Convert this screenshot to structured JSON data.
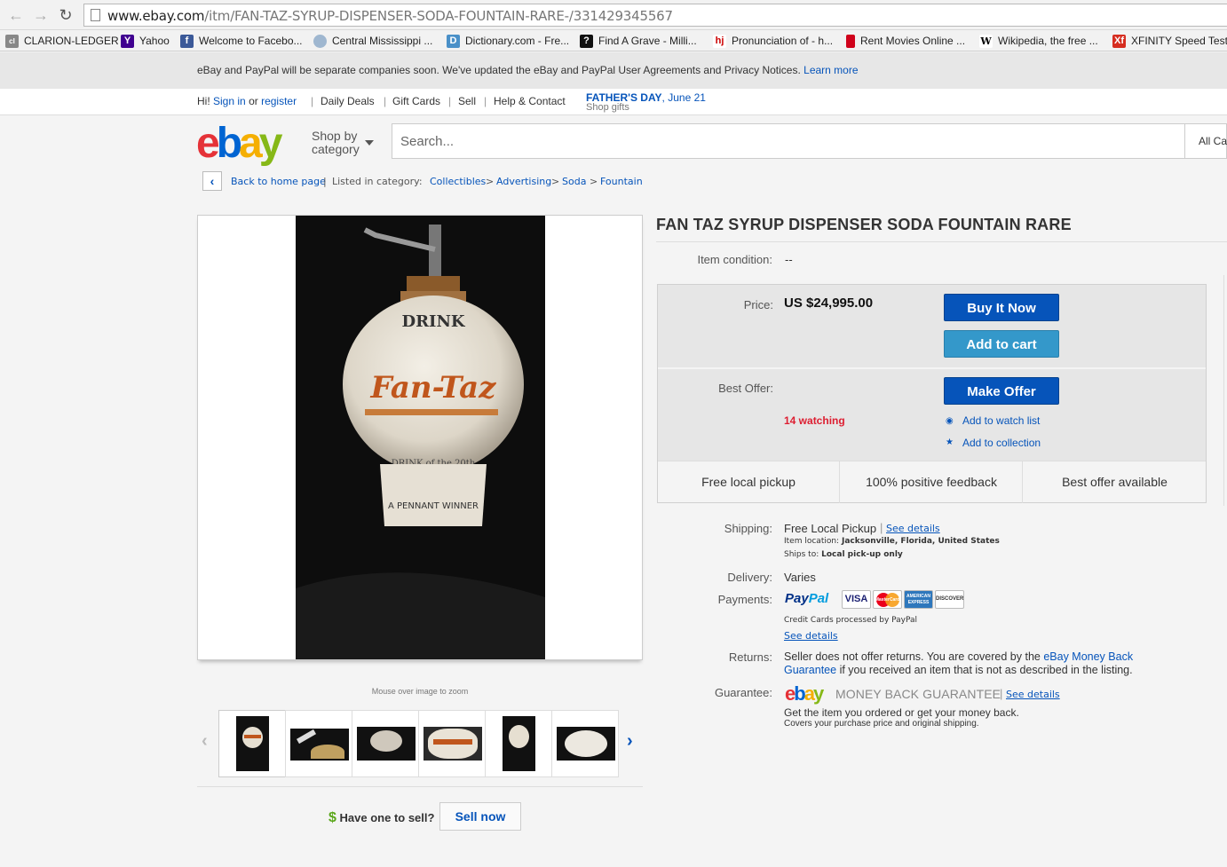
{
  "browser": {
    "url_domain": "www.ebay.com",
    "url_path": "/itm/FAN-TAZ-SYRUP-DISPENSER-SODA-FOUNTAIN-RARE-/331429345567",
    "bookmarks": [
      {
        "label": "CLARION-LEDGER",
        "icon": "cl-icon",
        "color": "#777777"
      },
      {
        "label": "Yahoo",
        "icon": "yahoo-icon",
        "color": "#400090"
      },
      {
        "label": "Welcome to Facebo...",
        "icon": "facebook-icon",
        "color": "#3b5998"
      },
      {
        "label": "Central Mississippi ...",
        "icon": "globe-icon",
        "color": "#6a8fb8"
      },
      {
        "label": "Dictionary.com - Fre...",
        "icon": "dictionary-icon",
        "color": "#4a90c8"
      },
      {
        "label": "Find A Grave - Milli...",
        "icon": "findagrave-icon",
        "color": "#111111"
      },
      {
        "label": "Pronunciation of - h...",
        "icon": "hj-icon",
        "color": "#cc0000"
      },
      {
        "label": "Rent Movies Online ...",
        "icon": "redbox-icon",
        "color": "#d0021b"
      },
      {
        "label": "Wikipedia, the free ...",
        "icon": "wikipedia-icon",
        "color": "#ffffff"
      },
      {
        "label": "XFINITY Speed Test",
        "icon": "xfinity-icon",
        "color": "#d62d20"
      }
    ]
  },
  "notice": {
    "text": "eBay and PayPal will be separate companies soon. We've updated the eBay and PayPal User Agreements and Privacy Notices.",
    "link": "Learn more"
  },
  "toplinks": {
    "hi": "Hi!",
    "sign_in": "Sign in",
    "or": "or",
    "register": "register",
    "daily_deals": "Daily Deals",
    "gift_cards": "Gift Cards",
    "sell": "Sell",
    "help": "Help & Contact",
    "promo_title": "FATHER'S DAY",
    "promo_date": ", June 21",
    "promo_sub": "Shop gifts"
  },
  "header": {
    "logo": [
      "e",
      "b",
      "a",
      "y"
    ],
    "shop_by_1": "Shop by",
    "shop_by_2": "category",
    "search_placeholder": "Search...",
    "search_category": "All Ca"
  },
  "breadcrumb": {
    "back": "Back to home page",
    "listed": "Listed in category:",
    "items": [
      "Collectibles",
      "Advertising",
      "Soda",
      "Fountain"
    ]
  },
  "gallery": {
    "zoom_hint": "Mouse over image to zoom",
    "product_text": {
      "drink": "DRINK",
      "brand": "Fan-Taz",
      "band": "DRINK of the 20th",
      "base": "A PENNANT WINNER"
    }
  },
  "sell": {
    "dollar": "$",
    "question": "Have one to sell?",
    "button": "Sell now"
  },
  "item": {
    "title": "FAN TAZ SYRUP DISPENSER SODA FOUNTAIN RARE",
    "condition_label": "Item condition:",
    "condition_value": "--",
    "price_label": "Price:",
    "price": "US $24,995.00",
    "buy_now": "Buy It Now",
    "add_to_cart": "Add to cart",
    "best_offer_label": "Best Offer:",
    "make_offer": "Make Offer",
    "watching": "14 watching",
    "add_watch": "Add to watch list",
    "add_collection": "Add to collection",
    "features": [
      "Free local pickup",
      "100% positive feedback",
      "Best offer available"
    ]
  },
  "details": {
    "shipping_label": "Shipping:",
    "shipping_value": "Free Local Pickup",
    "see_details": "See details",
    "item_location_label": "Item location:",
    "item_location": "Jacksonville, Florida, United States",
    "ships_to_label": "Ships to:",
    "ships_to": "Local pick-up only",
    "delivery_label": "Delivery:",
    "delivery_value": "Varies",
    "payments_label": "Payments:",
    "paypal_1": "Pay",
    "paypal_2": "Pal",
    "cards": [
      "VISA",
      "MasterCard",
      "AMERICAN EXPRESS",
      "DISCOVER"
    ],
    "cc_note": "Credit Cards processed by PayPal",
    "returns_label": "Returns:",
    "returns_text_1": "Seller does not offer returns. You are covered by the",
    "returns_link_1": "eBay Money Back",
    "returns_link_2": "Guarantee",
    "returns_text_2": "if you received an item that is not as described in the listing.",
    "guarantee_label": "Guarantee:",
    "mbg_text": "MONEY BACK GUARANTEE",
    "guarantee_line_1": "Get the item you ordered or get your money back.",
    "guarantee_line_2": "Covers your purchase price and original shipping."
  }
}
